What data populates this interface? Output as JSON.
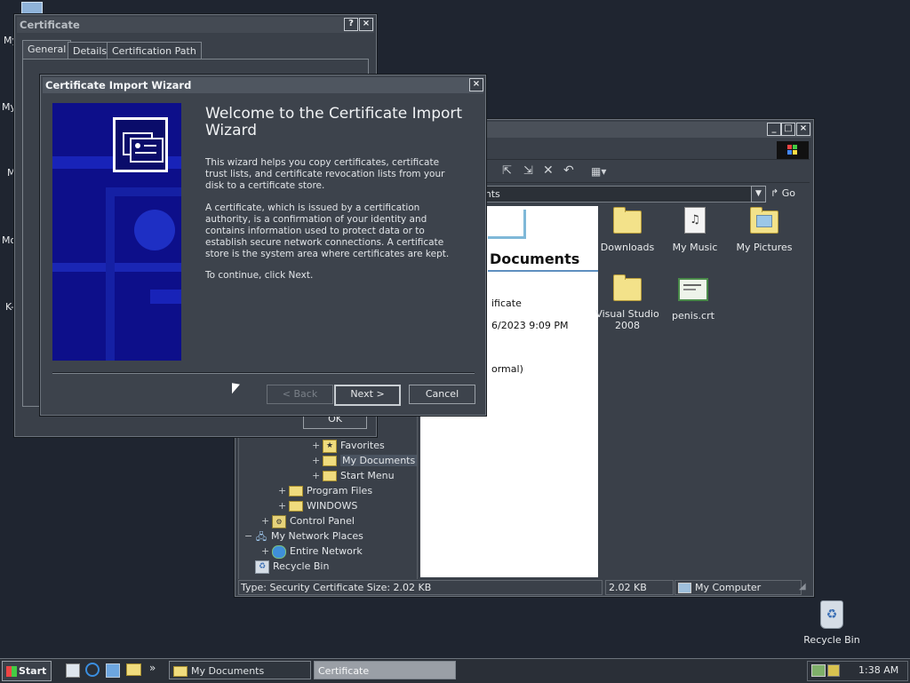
{
  "desktop": {
    "left_labels": [
      "My",
      "My",
      "M",
      "Mo",
      "K-"
    ],
    "recycle_bin_label": "Recycle Bin"
  },
  "cert_dialog": {
    "title": "Certificate",
    "tabs": [
      "General",
      "Details",
      "Certification Path"
    ],
    "ok_label": "OK"
  },
  "wizard": {
    "title": "Certificate Import Wizard",
    "heading": "Welcome to the Certificate Import Wizard",
    "para1": "This wizard helps you copy certificates, certificate trust lists, and certificate revocation lists from your disk to a certificate store.",
    "para2": "A certificate, which is issued by a certification authority, is a confirmation of your identity and contains information used to protect data or to establish secure network connections. A certificate store is the system area where certificates are kept.",
    "para3": "To continue, click Next.",
    "back_label": "< Back",
    "next_label": "Next >",
    "cancel_label": "Cancel"
  },
  "explorer": {
    "address_value": "ents",
    "go_label": "Go",
    "panel_title": "Documents",
    "details_type": "ificate",
    "details_date": "6/2023 9:09 PM",
    "details_attr": "ormal)",
    "files": [
      {
        "name": "Downloads",
        "icon": "folder-icon"
      },
      {
        "name": "My Music",
        "icon": "music-folder-icon"
      },
      {
        "name": "My Pictures",
        "icon": "pictures-folder-icon"
      },
      {
        "name": "Visual Studio 2008",
        "icon": "folder-icon"
      },
      {
        "name": "penis.crt",
        "icon": "certificate-file-icon"
      }
    ],
    "tree": [
      {
        "label": "Favorites",
        "pm": "+"
      },
      {
        "label": "My Documents",
        "pm": "+"
      },
      {
        "label": "Start Menu",
        "pm": "+"
      },
      {
        "label": "Program Files",
        "pm": "+"
      },
      {
        "label": "WINDOWS",
        "pm": "+"
      },
      {
        "label": "Control Panel",
        "pm": "+"
      },
      {
        "label": "My Network Places",
        "pm": "−"
      },
      {
        "label": "Entire Network",
        "pm": "+"
      },
      {
        "label": "Recycle Bin",
        "pm": ""
      }
    ],
    "status_left": "Type: Security Certificate Size: 2.02 KB",
    "status_size": "2.02 KB",
    "status_location": "My Computer"
  },
  "taskbar": {
    "start_label": "Start",
    "tasks": [
      "My Documents",
      "Certificate"
    ],
    "clock": "1:38 AM",
    "chevron": "»"
  }
}
